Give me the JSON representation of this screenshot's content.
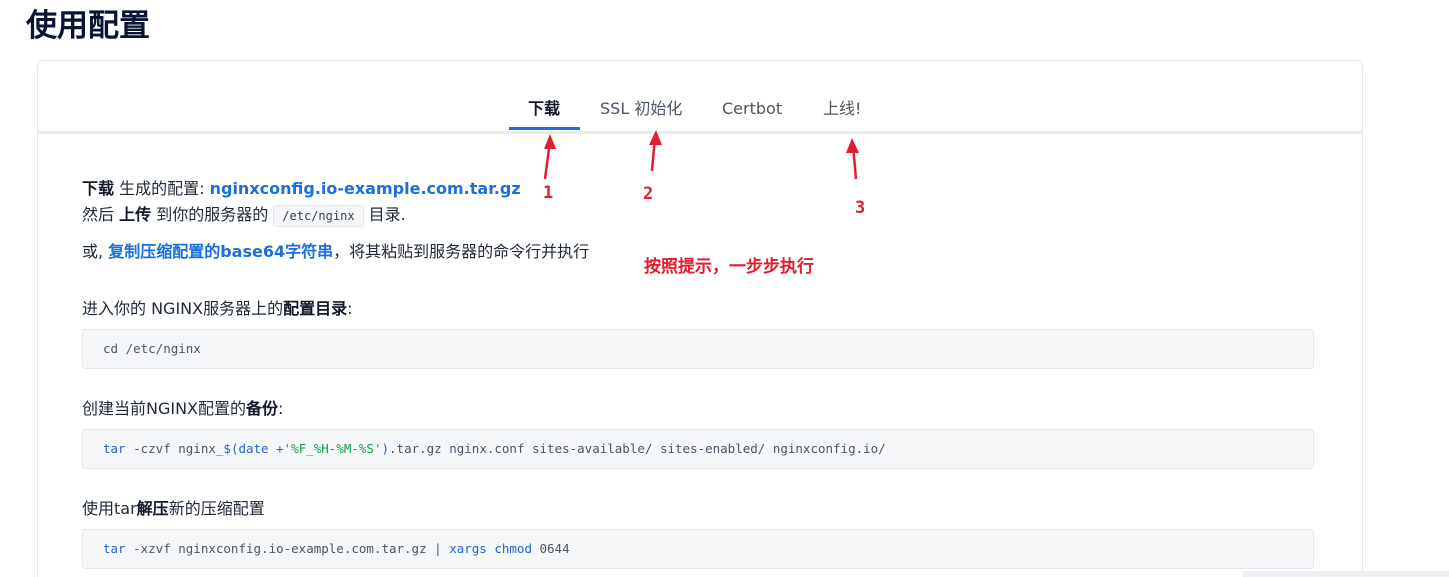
{
  "page": {
    "title": "使用配置"
  },
  "tabs": [
    {
      "label": "下载"
    },
    {
      "label": "SSL 初始化"
    },
    {
      "label": "Certbot"
    },
    {
      "label": "上线!"
    }
  ],
  "download": {
    "line1_bold": "下载",
    "line1_text": " 生成的配置: ",
    "line1_link": "nginxconfig.io-example.com.tar.gz",
    "line2_text_a": "然后 ",
    "line2_bold": "上传",
    "line2_text_b": " 到你的服务器的 ",
    "line2_code": "/etc/nginx",
    "line2_text_c": " 目录.",
    "line3_text_a": "或, ",
    "line3_link": "复制压缩配置的base64字符串",
    "line3_text_b": "，将其粘贴到服务器的命令行并执行"
  },
  "steps": [
    {
      "label_a": "进入你的 NGINX服务器上的",
      "label_bold": "配置目录",
      "label_b": ":",
      "code": "cd /etc/nginx"
    },
    {
      "label_a": "创建当前NGINX配置的",
      "label_bold": "备份",
      "label_b": ":",
      "code_kw1": "tar",
      "code_a": " -czvf nginx_",
      "code_kw2": "$(date +",
      "code_str": "'%F_%H-%M-%S'",
      "code_kw3": ")",
      "code_b": ".tar.gz nginx.conf sites-available/ sites-enabled/ nginxconfig.io/"
    },
    {
      "label_a": "使用tar",
      "label_bold": "解压",
      "label_b": "新的压缩配置",
      "code_kw1": "tar",
      "code_a": " -xzvf nginxconfig.io-example.com.tar.gz | ",
      "code_kw2": "xargs chmod",
      "code_b": " 0644"
    }
  ],
  "annotations": {
    "num1": "1",
    "num2": "2",
    "num3": "3",
    "hint": "按照提示，一步步执行",
    "color": "#e11d2e"
  },
  "colors": {
    "accent": "#1e6fd9",
    "link": "#1a6fd8",
    "title": "#0b1533"
  }
}
